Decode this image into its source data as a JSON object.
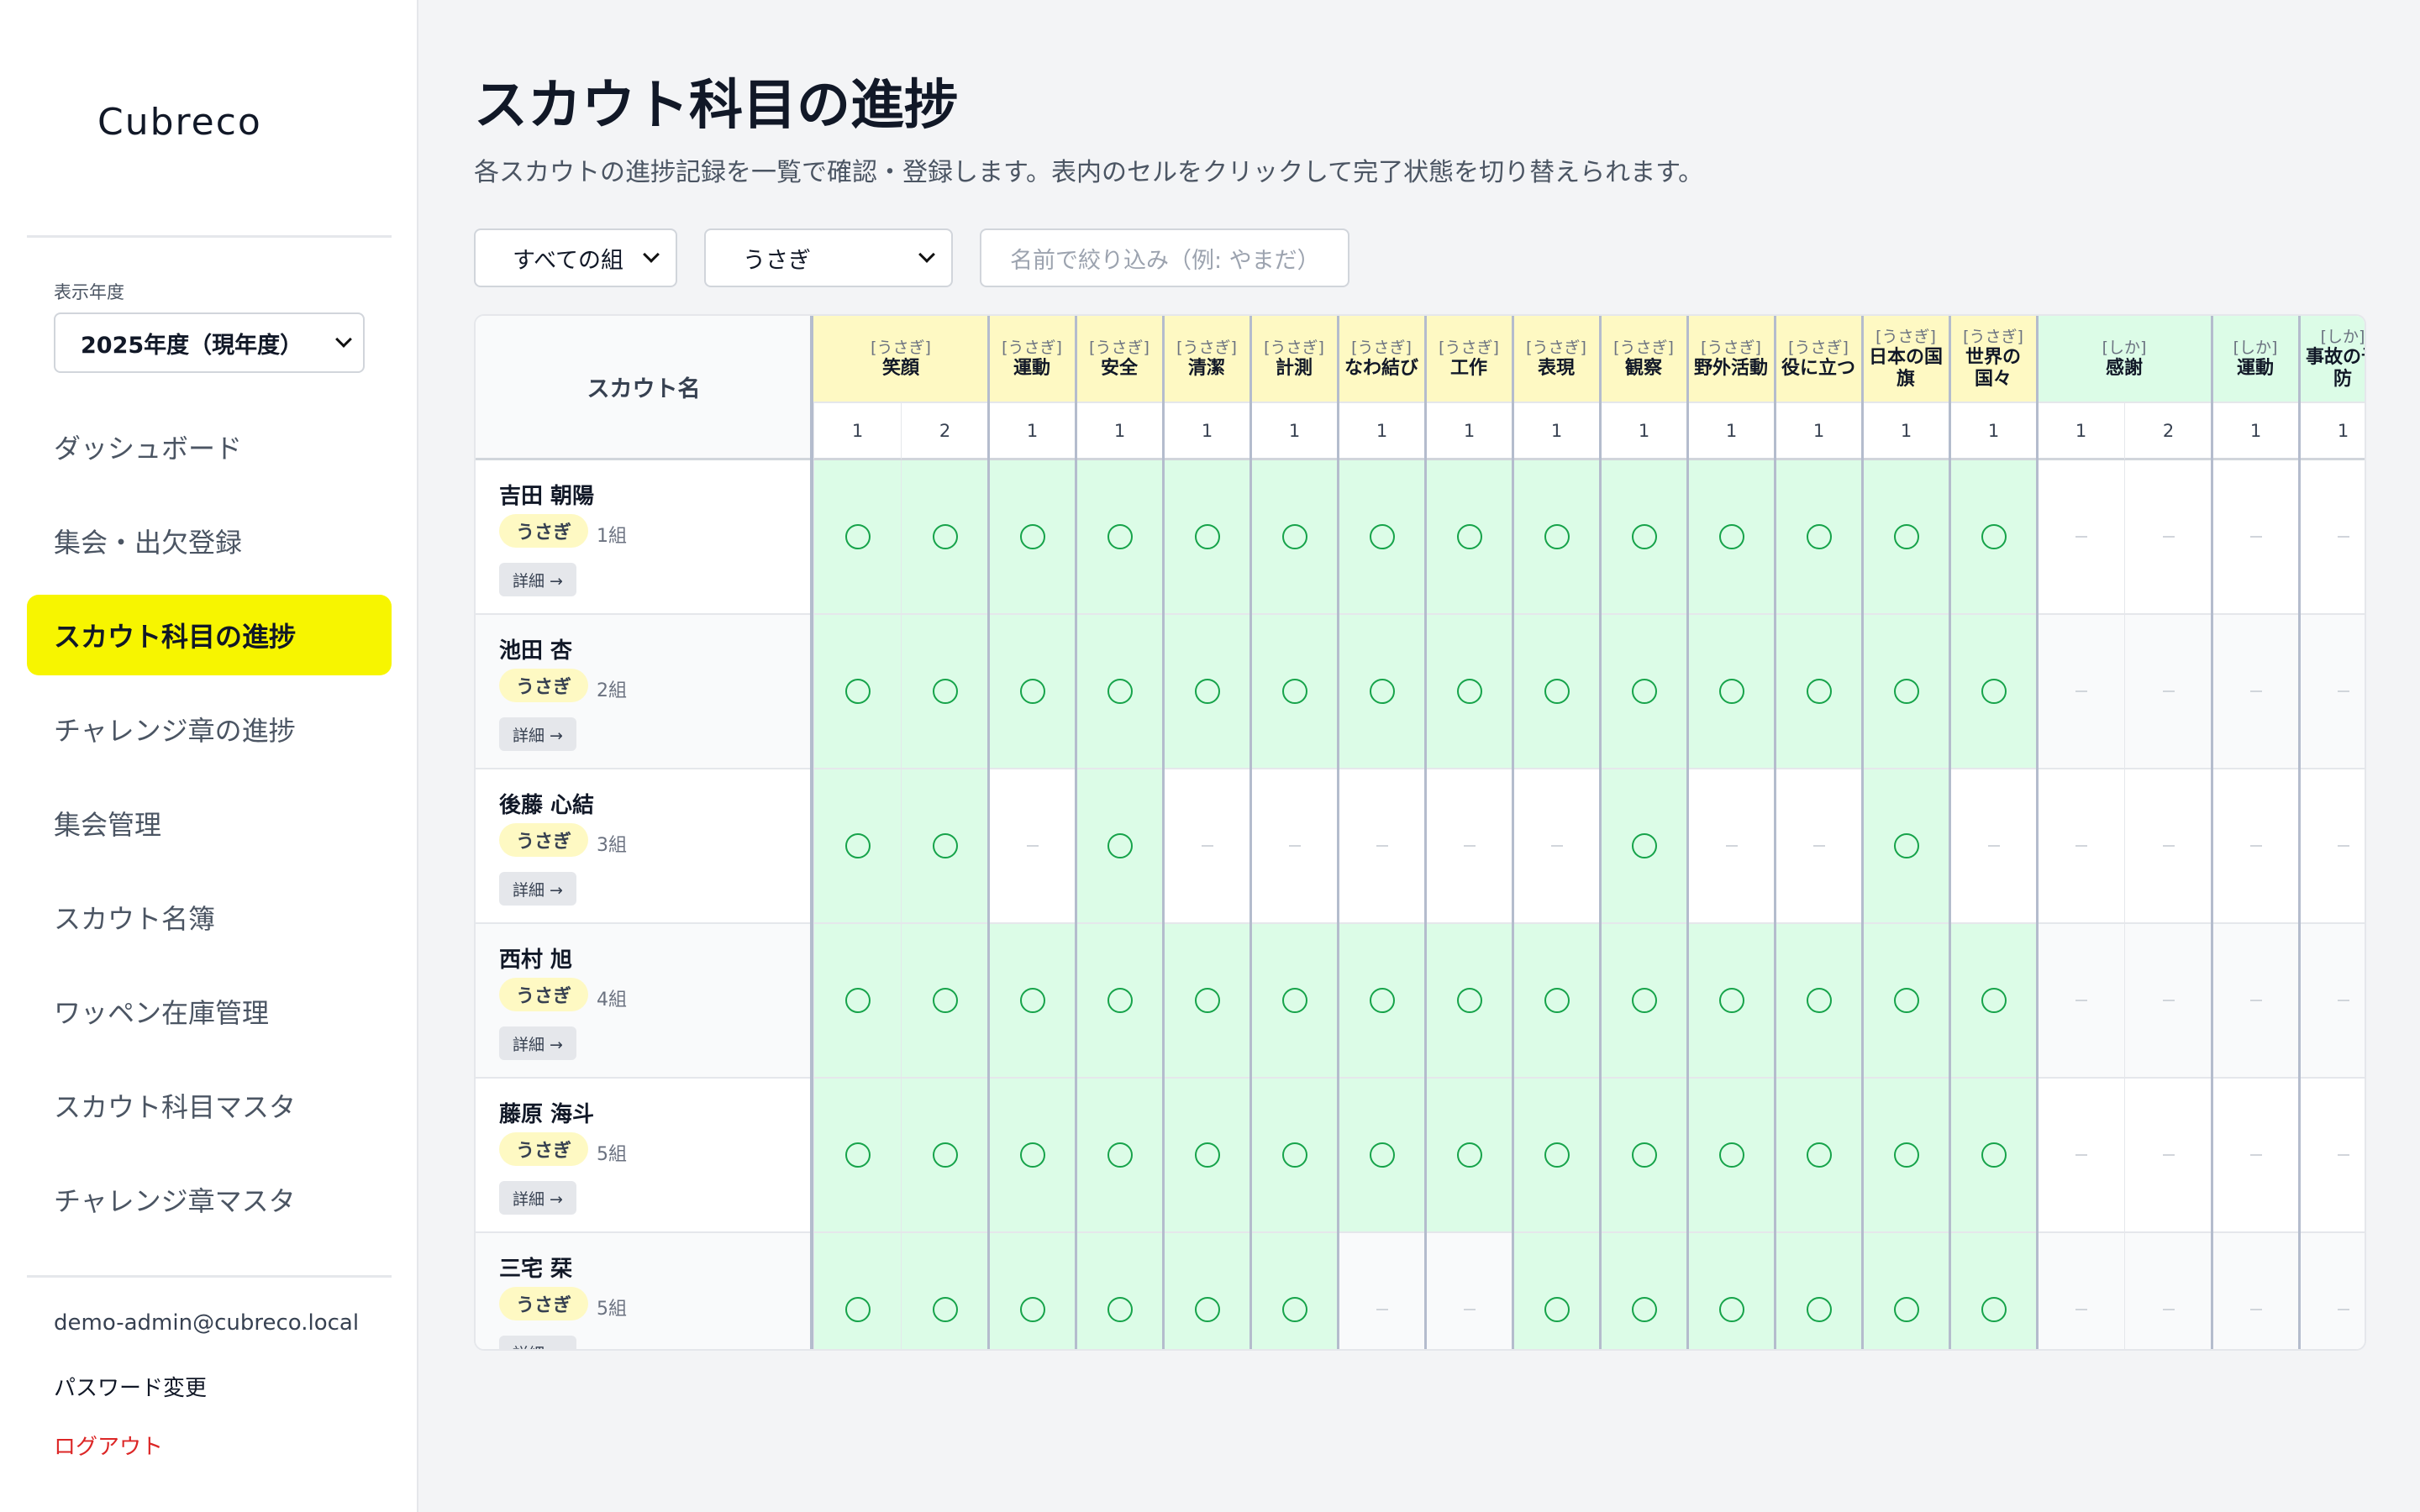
{
  "sidebar": {
    "logo": "Cubreco",
    "year_label": "表示年度",
    "year_value": "2025年度（現年度）",
    "nav": [
      {
        "label": "ダッシュボード"
      },
      {
        "label": "集会・出欠登録"
      },
      {
        "label": "スカウト科目の進捗",
        "active": true
      },
      {
        "label": "チャレンジ章の進捗"
      },
      {
        "label": "集会管理"
      },
      {
        "label": "スカウト名簿"
      },
      {
        "label": "ワッペン在庫管理"
      },
      {
        "label": "スカウト科目マスタ"
      },
      {
        "label": "チャレンジ章マスタ"
      }
    ],
    "user_email": "demo-admin@cubreco.local",
    "password_change": "パスワード変更",
    "logout": "ログアウト"
  },
  "page": {
    "title": "スカウト科目の進捗",
    "description": "各スカウトの進捗記録を一覧で確認・登録します。表内のセルをクリックして完了状態を切り替えられます。"
  },
  "filters": {
    "group_select": "すべての組",
    "rank_select": "うさぎ",
    "name_placeholder": "名前で絞り込み（例: やまだ）"
  },
  "table": {
    "name_header": "スカウト名",
    "detail_label": "詳細 →",
    "colors": {
      "usagi_header": "#fef9c3",
      "shika_header": "#dcfce7",
      "done": "#dcfce7",
      "done_mark": "#16a34a"
    },
    "subjects": [
      {
        "cat": "[うさぎ]",
        "title": "笑顔",
        "steps": [
          "1",
          "2"
        ],
        "rank": "usagi"
      },
      {
        "cat": "[うさぎ]",
        "title": "運動",
        "steps": [
          "1"
        ],
        "rank": "usagi"
      },
      {
        "cat": "[うさぎ]",
        "title": "安全",
        "steps": [
          "1"
        ],
        "rank": "usagi"
      },
      {
        "cat": "[うさぎ]",
        "title": "清潔",
        "steps": [
          "1"
        ],
        "rank": "usagi"
      },
      {
        "cat": "[うさぎ]",
        "title": "計測",
        "steps": [
          "1"
        ],
        "rank": "usagi"
      },
      {
        "cat": "[うさぎ]",
        "title": "なわ結び",
        "steps": [
          "1"
        ],
        "rank": "usagi"
      },
      {
        "cat": "[うさぎ]",
        "title": "工作",
        "steps": [
          "1"
        ],
        "rank": "usagi"
      },
      {
        "cat": "[うさぎ]",
        "title": "表現",
        "steps": [
          "1"
        ],
        "rank": "usagi"
      },
      {
        "cat": "[うさぎ]",
        "title": "観察",
        "steps": [
          "1"
        ],
        "rank": "usagi"
      },
      {
        "cat": "[うさぎ]",
        "title": "野外活動",
        "steps": [
          "1"
        ],
        "rank": "usagi"
      },
      {
        "cat": "[うさぎ]",
        "title": "役に立つ",
        "steps": [
          "1"
        ],
        "rank": "usagi"
      },
      {
        "cat": "[うさぎ]",
        "title": "日本の国旗",
        "steps": [
          "1"
        ],
        "rank": "usagi"
      },
      {
        "cat": "[うさぎ]",
        "title": "世界の国々",
        "steps": [
          "1"
        ],
        "rank": "usagi"
      },
      {
        "cat": "[しか]",
        "title": "感謝",
        "steps": [
          "1",
          "2"
        ],
        "rank": "shika"
      },
      {
        "cat": "[しか]",
        "title": "運動",
        "steps": [
          "1"
        ],
        "rank": "shika"
      },
      {
        "cat": "[しか]",
        "title": "事故の予防",
        "steps": [
          "1"
        ],
        "rank": "shika"
      }
    ],
    "rows": [
      {
        "name": "吉田 朝陽",
        "rank": "うさぎ",
        "group": "1組",
        "done": [
          1,
          1,
          1,
          1,
          1,
          1,
          1,
          1,
          1,
          1,
          1,
          1,
          1,
          1,
          0,
          0,
          0,
          0
        ]
      },
      {
        "name": "池田 杏",
        "rank": "うさぎ",
        "group": "2組",
        "done": [
          1,
          1,
          1,
          1,
          1,
          1,
          1,
          1,
          1,
          1,
          1,
          1,
          1,
          1,
          0,
          0,
          0,
          0
        ]
      },
      {
        "name": "後藤 心結",
        "rank": "うさぎ",
        "group": "3組",
        "done": [
          1,
          1,
          0,
          1,
          0,
          0,
          0,
          0,
          0,
          1,
          0,
          0,
          1,
          0,
          0,
          0,
          0,
          0
        ]
      },
      {
        "name": "西村 旭",
        "rank": "うさぎ",
        "group": "4組",
        "done": [
          1,
          1,
          1,
          1,
          1,
          1,
          1,
          1,
          1,
          1,
          1,
          1,
          1,
          1,
          0,
          0,
          0,
          0
        ]
      },
      {
        "name": "藤原 海斗",
        "rank": "うさぎ",
        "group": "5組",
        "done": [
          1,
          1,
          1,
          1,
          1,
          1,
          1,
          1,
          1,
          1,
          1,
          1,
          1,
          1,
          0,
          0,
          0,
          0
        ]
      },
      {
        "name": "三宅 栞",
        "rank": "うさぎ",
        "group": "5組",
        "done": [
          1,
          1,
          1,
          1,
          1,
          1,
          0,
          0,
          1,
          1,
          1,
          1,
          1,
          1,
          0,
          0,
          0,
          0
        ]
      }
    ]
  }
}
